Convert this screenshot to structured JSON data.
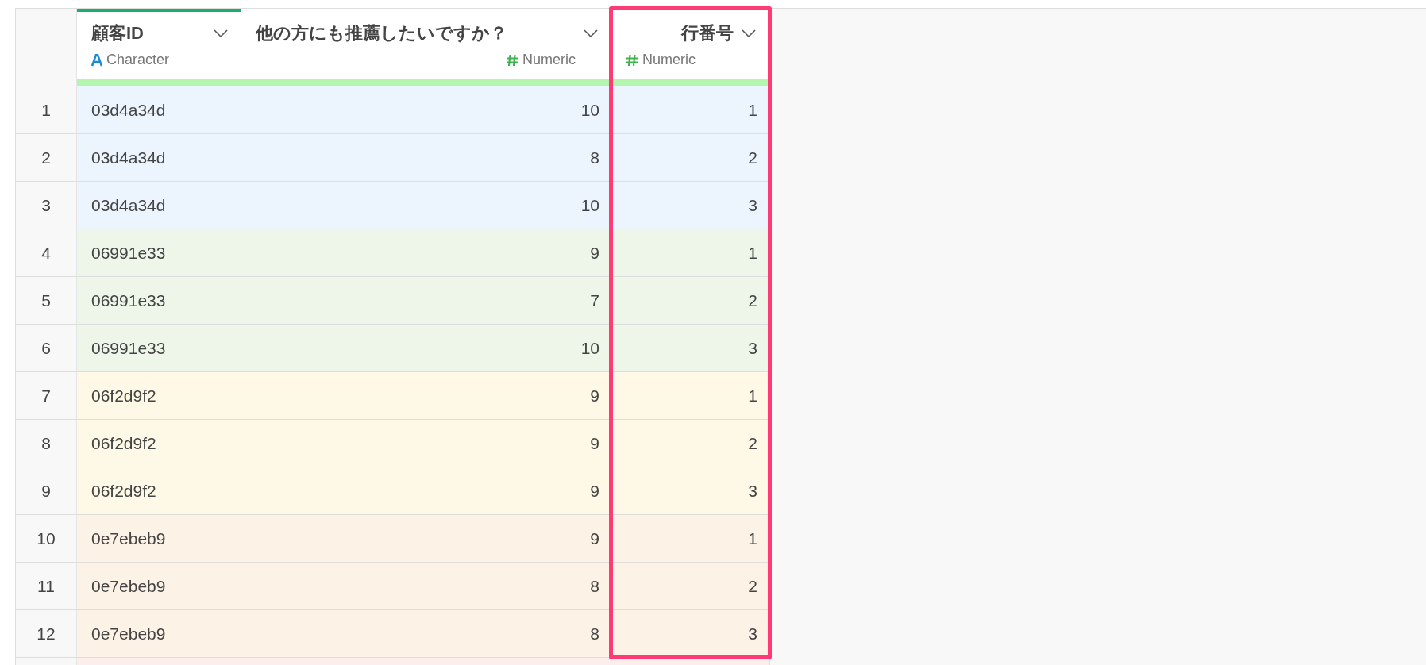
{
  "columns": [
    {
      "title": "顧客ID",
      "kind": "character",
      "type_label": "Character",
      "selected": true,
      "highlighted": false
    },
    {
      "title": "他の方にも推薦したいですか？",
      "kind": "numeric",
      "type_label": "Numeric",
      "selected": false,
      "highlighted": false
    },
    {
      "title": "行番号",
      "kind": "numeric",
      "type_label": "Numeric",
      "selected": false,
      "highlighted": true
    }
  ],
  "rows": [
    {
      "num": "1",
      "color": "#ecf4fd",
      "cells": [
        "03d4a34d",
        "10",
        "1"
      ]
    },
    {
      "num": "2",
      "color": "#ecf4fd",
      "cells": [
        "03d4a34d",
        "8",
        "2"
      ]
    },
    {
      "num": "3",
      "color": "#ecf4fd",
      "cells": [
        "03d4a34d",
        "10",
        "3"
      ]
    },
    {
      "num": "4",
      "color": "#eef6ea",
      "cells": [
        "06991e33",
        "9",
        "1"
      ]
    },
    {
      "num": "5",
      "color": "#eef6ea",
      "cells": [
        "06991e33",
        "7",
        "2"
      ]
    },
    {
      "num": "6",
      "color": "#eef6ea",
      "cells": [
        "06991e33",
        "10",
        "3"
      ]
    },
    {
      "num": "7",
      "color": "#fdf9e6",
      "cells": [
        "06f2d9f2",
        "9",
        "1"
      ]
    },
    {
      "num": "8",
      "color": "#fdf9e6",
      "cells": [
        "06f2d9f2",
        "9",
        "2"
      ]
    },
    {
      "num": "9",
      "color": "#fdf9e6",
      "cells": [
        "06f2d9f2",
        "9",
        "3"
      ]
    },
    {
      "num": "10",
      "color": "#fdf2e6",
      "cells": [
        "0e7ebeb9",
        "9",
        "1"
      ]
    },
    {
      "num": "11",
      "color": "#fdf2e6",
      "cells": [
        "0e7ebeb9",
        "8",
        "2"
      ]
    },
    {
      "num": "12",
      "color": "#fdf2e6",
      "cells": [
        "0e7ebeb9",
        "8",
        "3"
      ]
    }
  ]
}
